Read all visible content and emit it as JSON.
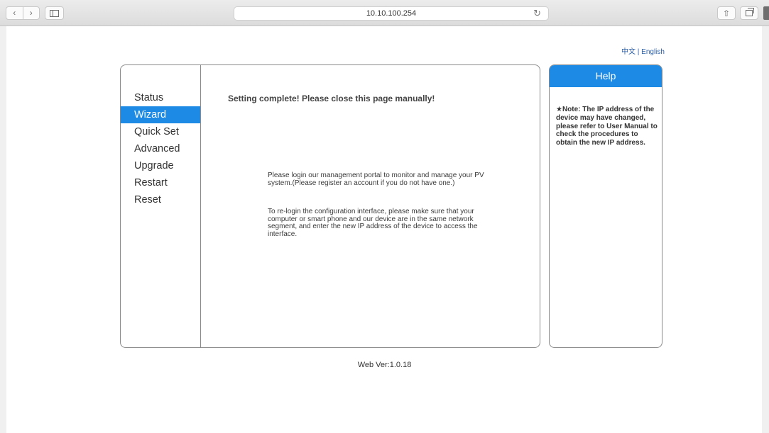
{
  "browser": {
    "back_icon": "‹",
    "forward_icon": "›",
    "url": "10.10.100.254",
    "reload_icon": "↻",
    "share_icon": "⇧"
  },
  "lang": {
    "chinese": "中文",
    "separator": " | ",
    "english": "English"
  },
  "menu": {
    "items": [
      {
        "label": "Status"
      },
      {
        "label": "Wizard"
      },
      {
        "label": "Quick Set"
      },
      {
        "label": "Advanced"
      },
      {
        "label": "Upgrade"
      },
      {
        "label": "Restart"
      },
      {
        "label": "Reset"
      }
    ],
    "active": "Wizard"
  },
  "content": {
    "heading": "Setting complete! Please close this page manually!",
    "para1": "Please login our management portal to monitor and manage your PV system.(Please register an account if you do not have one.)",
    "para2": "To re-login the configuration interface, please make sure that your computer or smart phone and our device are in the same network segment, and enter the new IP address of the device to access the interface."
  },
  "help": {
    "title": "Help",
    "note": "★Note: The IP address of the device may have changed, please refer to User Manual to check the procedures to obtain the new IP address."
  },
  "footer": {
    "web_version": "Web Ver:1.0.18"
  },
  "colors": {
    "accent": "#1d8be6",
    "link": "#2c5fa8",
    "border": "#8a8a8a"
  }
}
